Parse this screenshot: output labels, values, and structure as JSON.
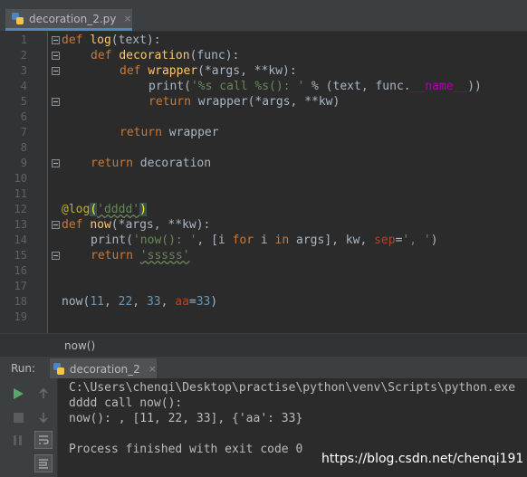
{
  "editor_tab": {
    "filename": "decoration_2.py",
    "close": "×"
  },
  "gutter": {
    "line_numbers": [
      "1",
      "2",
      "3",
      "4",
      "5",
      "6",
      "7",
      "8",
      "9",
      "10",
      "11",
      "12",
      "13",
      "14",
      "15",
      "16",
      "17",
      "18",
      "19"
    ]
  },
  "code": {
    "l1": {
      "a": "def",
      "b": " ",
      "c": "log",
      "d": "(text):"
    },
    "l2": {
      "a": "def",
      "b": " ",
      "c": "decoration",
      "d": "(func):"
    },
    "l3": {
      "a": "def",
      "b": " ",
      "c": "wrapper",
      "d": "(*args, **kw):"
    },
    "l4": {
      "a": "print(",
      "b": "'%s call %s(): '",
      "c": " % (text, func.",
      "d": "__name__",
      "e": "))"
    },
    "l5": {
      "a": "return",
      "b": " wrapper(*args, **kw)"
    },
    "l7": {
      "a": "return",
      "b": " wrapper"
    },
    "l9": {
      "a": "return",
      "b": " decoration"
    },
    "l12": {
      "a": "@log",
      "b": "(",
      "c": "'dddd'",
      "d": ")"
    },
    "l13": {
      "a": "def",
      "b": " ",
      "c": "now",
      "d": "(*args, **kw):"
    },
    "l14": {
      "a": "print(",
      "b": "'now(): '",
      "c": ", [i ",
      "d": "for",
      "e": " i ",
      "f": "in",
      "g": " args], kw, ",
      "h": "sep",
      "i": "=",
      "j": "', '",
      "k": ")"
    },
    "l15": {
      "a": "return",
      "b": " ",
      "c": "'sssss'"
    },
    "l18": {
      "a": "now(",
      "b": "11",
      "c": ", ",
      "d": "22",
      "e": ", ",
      "f": "33",
      "g": ", ",
      "h": "aa",
      "i": "=",
      "j": "33",
      "k": ")"
    }
  },
  "breadcrumb": {
    "text": "now()"
  },
  "run": {
    "label": "Run:",
    "tab_name": "decoration_2",
    "close": "×",
    "output": [
      "C:\\Users\\chenqi\\Desktop\\practise\\python\\venv\\Scripts\\python.exe",
      "dddd call now():",
      "now(): , [11, 22, 33], {'aa': 33}",
      "",
      "Process finished with exit code 0"
    ]
  },
  "watermark": {
    "text": "https://blog.csdn.net/chenqi191"
  },
  "colors": {
    "keyword": "#cc7832",
    "function": "#ffc66d",
    "string": "#6a8759",
    "number": "#6897bb",
    "decorator": "#bbb529",
    "background": "#2b2b2b"
  }
}
